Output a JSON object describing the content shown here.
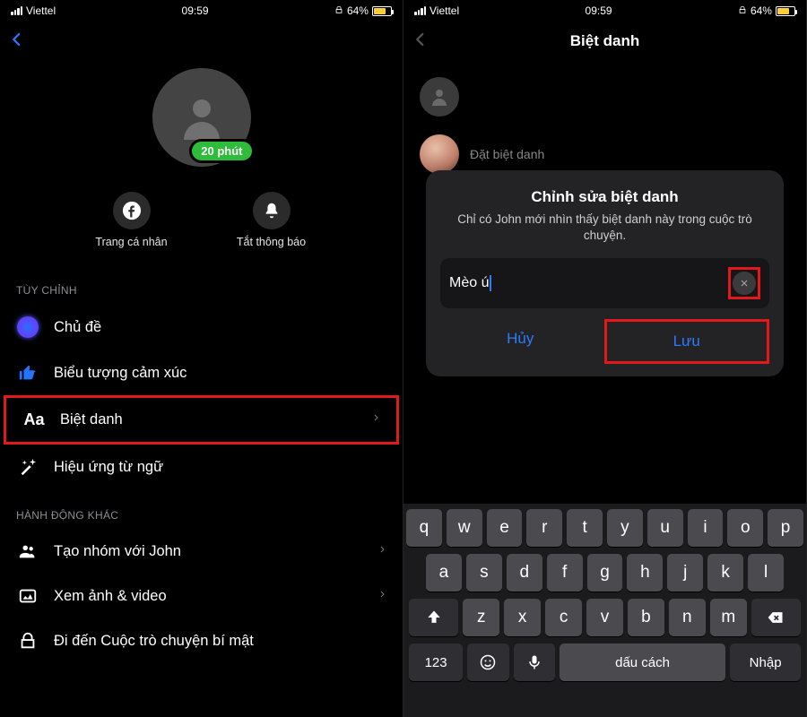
{
  "status": {
    "carrier": "Viettel",
    "time": "09:59",
    "battery_pct_text": "64%",
    "battery_fill_pct": 64
  },
  "left": {
    "presence": "20 phút",
    "actions": {
      "profile": "Trang cá nhân",
      "mute": "Tắt thông báo"
    },
    "section_customize": "TÙY CHỈNH",
    "rows": {
      "theme": "Chủ đề",
      "emoji": "Biểu tượng cảm xúc",
      "nickname": "Biệt danh",
      "word_effects": "Hiệu ứng từ ngữ"
    },
    "section_other": "HÀNH ĐỘNG KHÁC",
    "other": {
      "create_group": "Tạo nhóm với John",
      "media": "Xem ảnh & video",
      "secret": "Đi đến Cuộc trò chuyện bí mật"
    }
  },
  "right": {
    "title": "Biệt danh",
    "placeholder_sub": "Đặt biệt danh",
    "modal": {
      "title": "Chỉnh sửa biệt danh",
      "subtitle": "Chỉ có John mới nhìn thấy biệt danh này trong cuộc trò chuyện.",
      "input_value": "Mèo ú",
      "cancel": "Hủy",
      "save": "Lưu"
    },
    "keyboard": {
      "r1": [
        "q",
        "w",
        "e",
        "r",
        "t",
        "y",
        "u",
        "i",
        "o",
        "p"
      ],
      "r2": [
        "a",
        "s",
        "d",
        "f",
        "g",
        "h",
        "j",
        "k",
        "l"
      ],
      "r3": [
        "z",
        "x",
        "c",
        "v",
        "b",
        "n",
        "m"
      ],
      "num": "123",
      "space": "dấu cách",
      "enter": "Nhập"
    }
  }
}
